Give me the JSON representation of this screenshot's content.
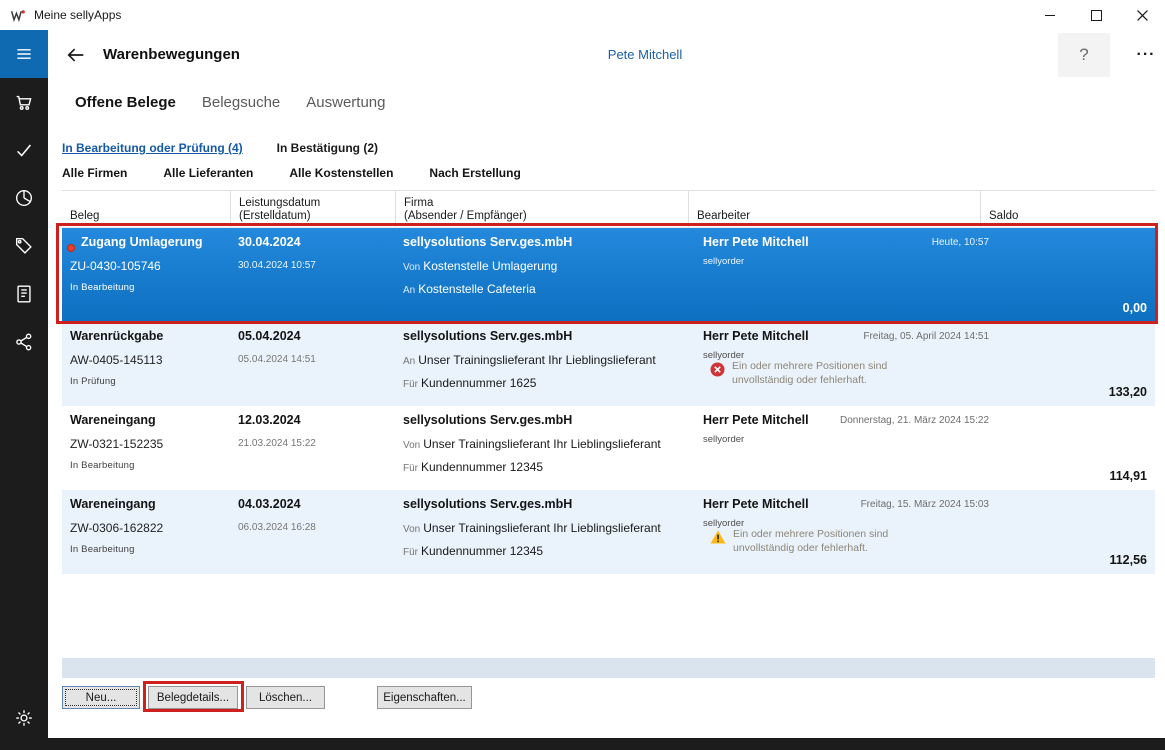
{
  "window": {
    "title": "Meine sellyApps"
  },
  "header": {
    "title": "Warenbewegungen",
    "user": "Pete Mitchell",
    "help": "?",
    "more": "···"
  },
  "sidebar": {
    "items": [
      {
        "icon": "hamburger-menu-icon"
      },
      {
        "icon": "shopping-cart-icon"
      },
      {
        "icon": "checkmark-icon"
      },
      {
        "icon": "pie-chart-icon"
      },
      {
        "icon": "tag-icon"
      },
      {
        "icon": "notebook-icon"
      },
      {
        "icon": "share-network-icon"
      }
    ],
    "settings_icon": "gear-icon"
  },
  "tabs": [
    {
      "label": "Offene Belege",
      "active": true
    },
    {
      "label": "Belegsuche",
      "active": false
    },
    {
      "label": "Auswertung",
      "active": false
    }
  ],
  "filters": {
    "status_links": [
      {
        "label": "In Bearbeitung oder Prüfung (4)",
        "active": true
      },
      {
        "label": "In Bestätigung (2)",
        "active": false
      }
    ],
    "dropdowns": [
      {
        "label": "Alle Firmen"
      },
      {
        "label": "Alle Lieferanten"
      },
      {
        "label": "Alle Kostenstellen"
      },
      {
        "label": "Nach Erstellung"
      }
    ]
  },
  "table": {
    "columns": [
      {
        "title": "Beleg",
        "subtitle": ""
      },
      {
        "title": "Leistungsdatum",
        "subtitle": "(Erstelldatum)"
      },
      {
        "title": "Firma",
        "subtitle": "(Absender / Empfänger)"
      },
      {
        "title": "Bearbeiter",
        "subtitle": ""
      },
      {
        "title": "Saldo",
        "subtitle": ""
      }
    ],
    "rows": [
      {
        "selected": true,
        "type": "Zugang Umlagerung",
        "number": "ZU-0430-105746",
        "status": "In Bearbeitung",
        "service_date": "30.04.2024",
        "created": "30.04.2024 10:57",
        "company": "sellysolutions Serv.ges.mbH",
        "line2_prefix": "Von",
        "line2_text": "Kostenstelle Umlagerung",
        "line3_prefix": "An",
        "line3_text": "Kostenstelle Cafeteria",
        "editor": "Herr Pete Mitchell",
        "editor_app": "sellyorder",
        "edited": "Heute, 10:57",
        "saldo": "0,00"
      },
      {
        "selected": false,
        "type": "Warenrückgabe",
        "number": "AW-0405-145113",
        "status": "In Prüfung",
        "service_date": "05.04.2024",
        "created": "05.04.2024 14:51",
        "company": "sellysolutions Serv.ges.mbH",
        "line2_prefix": "An",
        "line2_text": "Unser Trainingslieferant Ihr Lieblingslieferant",
        "line3_prefix": "Für",
        "line3_text": "Kundennummer 1625",
        "editor": "Herr Pete Mitchell",
        "editor_app": "sellyorder",
        "edited": "Freitag, 05. April 2024 14:51",
        "alert": {
          "kind": "error",
          "line1": "Ein oder mehrere Positionen sind",
          "line2": "unvollständig oder fehlerhaft."
        },
        "saldo": "133,20"
      },
      {
        "selected": false,
        "type": "Wareneingang",
        "number": "ZW-0321-152235",
        "status": "In Bearbeitung",
        "service_date": "12.03.2024",
        "created": "21.03.2024 15:22",
        "company": "sellysolutions Serv.ges.mbH",
        "line2_prefix": "Von",
        "line2_text": "Unser Trainingslieferant Ihr Lieblingslieferant",
        "line3_prefix": "Für",
        "line3_text": "Kundennummer 12345",
        "editor": "Herr Pete Mitchell",
        "editor_app": "sellyorder",
        "edited": "Donnerstag, 21. März 2024 15:22",
        "saldo": "114,91"
      },
      {
        "selected": false,
        "type": "Wareneingang",
        "number": "ZW-0306-162822",
        "status": "In Bearbeitung",
        "service_date": "04.03.2024",
        "created": "06.03.2024 16:28",
        "company": "sellysolutions Serv.ges.mbH",
        "line2_prefix": "Von",
        "line2_text": "Unser Trainingslieferant Ihr Lieblingslieferant",
        "line3_prefix": "Für",
        "line3_text": "Kundennummer 12345",
        "editor": "Herr Pete Mitchell",
        "editor_app": "sellyorder",
        "edited": "Freitag, 15. März 2024 15:03",
        "alert": {
          "kind": "warning",
          "line1": "Ein oder mehrere Positionen sind",
          "line2": "unvollständig oder fehlerhaft."
        },
        "saldo": "112,56"
      }
    ]
  },
  "buttons": [
    {
      "label": "Neu...",
      "focused": true
    },
    {
      "label": "Belegdetails...",
      "annotated": true
    },
    {
      "label": "Löschen..."
    },
    {
      "label": "Eigenschaften..."
    }
  ],
  "colors": {
    "accent_blue": "#1565ab",
    "selected_row_blue": "#1580d2",
    "row_alt_blue": "#eaf3fb",
    "sidebar_background": "#1c1c1c",
    "sidebar_menu_blue": "#0f6ab1",
    "annotation_red": "#cf2020",
    "error_red": "#d13438",
    "warning_yellow": "#fcb915"
  }
}
